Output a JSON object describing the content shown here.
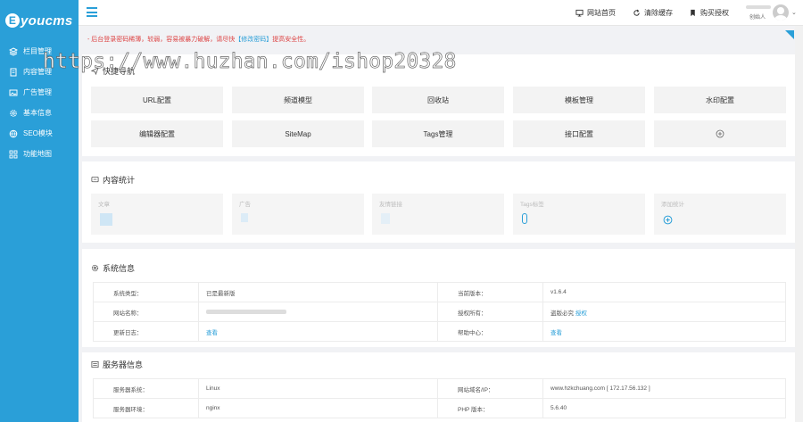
{
  "sidebar": {
    "logo": "youcms",
    "logo_letter": "E",
    "items": [
      {
        "label": "栏目管理",
        "icon": "layers-icon"
      },
      {
        "label": "内容管理",
        "icon": "document-icon"
      },
      {
        "label": "广告管理",
        "icon": "image-icon"
      },
      {
        "label": "基本信息",
        "icon": "gear-icon"
      },
      {
        "label": "SEO模块",
        "icon": "globe-icon"
      },
      {
        "label": "功能地图",
        "icon": "grid-icon"
      }
    ]
  },
  "header": {
    "links": [
      {
        "label": "网站首页",
        "icon": "monitor-icon"
      },
      {
        "label": "清除缓存",
        "icon": "refresh-icon"
      },
      {
        "label": "购买授权",
        "icon": "bookmark-icon"
      }
    ],
    "user_role": "创始人"
  },
  "notice": {
    "text": "- 后台登录密码稀薄，较弱，容易被暴力破解，请尽快",
    "link": "【修改密码】",
    "tail": "提高安全性。"
  },
  "watermark": "https://www.huzhan.com/ishop20328",
  "quick_nav": {
    "title": "快捷导航",
    "buttons": [
      "URL配置",
      "频道模型",
      "回收站",
      "模板管理",
      "水印配置",
      "编辑器配置",
      "SiteMap",
      "Tags管理",
      "接口配置"
    ]
  },
  "content_stats": {
    "title": "内容统计",
    "items": [
      "文章",
      "广告",
      "友情链接",
      "Tags标签",
      "添加统计"
    ]
  },
  "system_info": {
    "title": "系统信息",
    "rows": [
      [
        "系统类型：",
        "已是最新版",
        "当前版本：",
        "v1.6.4"
      ],
      [
        "网站名称：",
        "",
        "授权所有：",
        "盗版必究",
        "授权"
      ],
      [
        "更新日志：",
        "查看",
        "帮助中心：",
        "查看"
      ]
    ]
  },
  "server_info": {
    "title": "服务器信息",
    "rows": [
      [
        "服务器系统：",
        "Linux",
        "网站域名/IP：",
        "www.hzkchuang.com [ 172.17.56.132 ]"
      ],
      [
        "服务器环境：",
        "nginx",
        "PHP 版本：",
        "5.6.40"
      ]
    ]
  },
  "colors": {
    "accent": "#2a9fd8",
    "warning": "#dd4444"
  }
}
